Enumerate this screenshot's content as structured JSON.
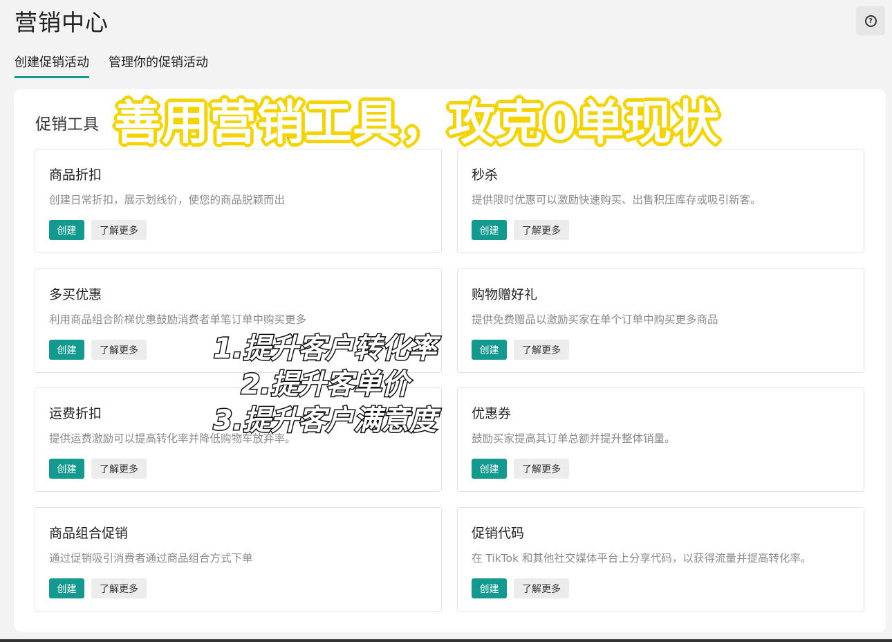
{
  "header": {
    "title": "营销中心",
    "help_icon": "question-circle-icon",
    "help_glyph": "?"
  },
  "tabs": [
    {
      "label": "创建促销活动",
      "active": true
    },
    {
      "label": "管理你的促销活动",
      "active": false
    }
  ],
  "section": {
    "title": "促销工具"
  },
  "cards": [
    {
      "title": "商品折扣",
      "desc": "创建日常折扣，展示划线价，使您的商品脱颖而出",
      "create_label": "创建",
      "more_label": "了解更多"
    },
    {
      "title": "秒杀",
      "desc": "提供限时优惠可以激励快速购买、出售积压库存或吸引新客。",
      "create_label": "创建",
      "more_label": "了解更多"
    },
    {
      "title": "多买优惠",
      "desc": "利用商品组合阶梯优惠鼓励消费者单笔订单中购买更多",
      "create_label": "创建",
      "more_label": "了解更多"
    },
    {
      "title": "购物赠好礼",
      "desc": "提供免费赠品以激励买家在单个订单中购买更多商品",
      "create_label": "创建",
      "more_label": "了解更多"
    },
    {
      "title": "运费折扣",
      "desc": "提供运费激励可以提高转化率并降低购物车放弃率。",
      "create_label": "创建",
      "more_label": "了解更多"
    },
    {
      "title": "优惠券",
      "desc": "鼓励买家提高其订单总额并提升整体销量。",
      "create_label": "创建",
      "more_label": "了解更多"
    },
    {
      "title": "商品组合促销",
      "desc": "通过促销吸引消费者通过商品组合方式下单",
      "create_label": "创建",
      "more_label": "了解更多"
    },
    {
      "title": "促销代码",
      "desc": "在 TikTok 和其他社交媒体平台上分享代码，以获得流量并提高转化率。",
      "create_label": "创建",
      "more_label": "了解更多"
    }
  ],
  "overlay": {
    "banner": "善用营销工具，攻克0单现状",
    "lines": [
      "1.提升客户转化率",
      "2.提升客单价",
      "3.提升客户满意度"
    ]
  },
  "colors": {
    "accent": "#14998f",
    "banner_outline": "#f3d400"
  }
}
